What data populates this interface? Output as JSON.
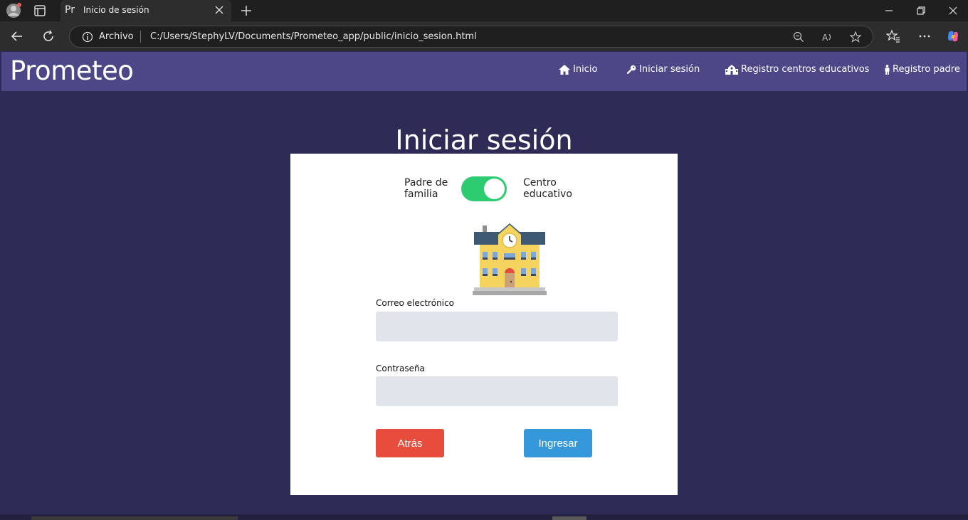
{
  "browser": {
    "tab_favicon": "Pr",
    "tab_title": "Inicio de sesión",
    "site_info_label": "Archivo",
    "url": "C:/Users/StephyLV/Documents/Prometeo_app/public/inicio_sesion.html"
  },
  "navbar": {
    "brand": "Prometeo",
    "links": [
      {
        "label": "Inicio",
        "icon": "home-icon"
      },
      {
        "label": "Iniciar sesión",
        "icon": "key-icon"
      },
      {
        "label": "Registro centros educativos",
        "icon": "school-icon"
      },
      {
        "label": "Registro padre",
        "icon": "person-icon"
      }
    ],
    "color": "#4c4787"
  },
  "page": {
    "title": "Iniciar sesión",
    "background": "#2e2b56"
  },
  "form": {
    "toggle_left": "Padre de familia",
    "toggle_right": "Centro educativo",
    "toggle_state": "Centro educativo",
    "image": "school-building-icon",
    "email_label": "Correo electrónico",
    "email_value": "",
    "password_label": "Contraseña",
    "password_value": "",
    "back_button": "Atrás",
    "submit_button": "Ingresar",
    "colors": {
      "toggle": "#2ecc71",
      "back": "#e74c3c",
      "submit": "#3498db"
    }
  }
}
